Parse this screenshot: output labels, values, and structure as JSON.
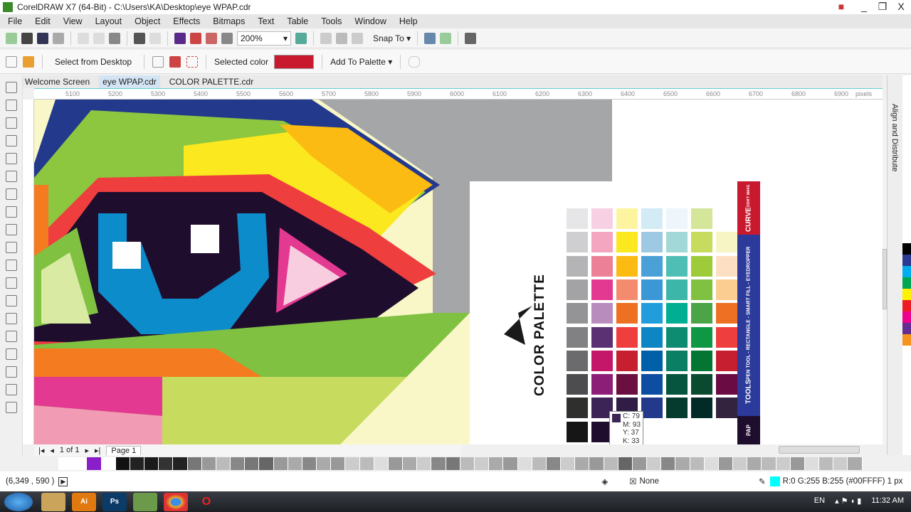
{
  "window": {
    "title": "CorelDRAW X7 (64-Bit) - C:\\Users\\KA\\Desktop\\eye WPAP.cdr",
    "minimize": "_",
    "restore": "❐",
    "close": "X"
  },
  "menu": [
    "File",
    "Edit",
    "View",
    "Layout",
    "Object",
    "Effects",
    "Bitmaps",
    "Text",
    "Table",
    "Tools",
    "Window",
    "Help"
  ],
  "toolbar": {
    "zoom": "200%",
    "snap_to": "Snap To"
  },
  "property_bar": {
    "select_from_desktop": "Select from Desktop",
    "selected_color_label": "Selected color",
    "selected_color": "#c8192e",
    "add_to_palette": "Add To Palette"
  },
  "tabs": [
    {
      "label": "Welcome Screen",
      "active": false
    },
    {
      "label": "eye WPAP.cdr",
      "active": true
    },
    {
      "label": "COLOR PALETTE.cdr",
      "active": false
    }
  ],
  "ruler": {
    "ticks": [
      "5100",
      "5200",
      "5300",
      "5400",
      "5500",
      "5600",
      "5700",
      "5800",
      "5900",
      "6000",
      "6100",
      "6200",
      "6300",
      "6400",
      "6500",
      "6600",
      "6700",
      "6800",
      "6900"
    ],
    "unit": "pixels"
  },
  "dock": {
    "align_distribute": "Align and Distribute"
  },
  "artboard": {
    "title": "COLOR PALETTE",
    "banner_top": "CURVE",
    "banner_top_small": "DON'T MAKE",
    "banner_mid_title": "TOOLS",
    "banner_mid_sub": "PEN TOOL - RECTANGLE - SMART FILL - EYEDROPPER",
    "banner_bottom": "PAP",
    "columns": [
      [
        "#e6e6e8",
        "#cfcfd1",
        "#b4b4b6",
        "#a3a3a5",
        "#949496",
        "#818183",
        "#6b6b6d",
        "#4d4d4f",
        "#2f2f2d",
        "#161616"
      ],
      [
        "#f8d0e4",
        "#f4a5c0",
        "#ec8097",
        "#e33990",
        "#b98cbe",
        "#5b3173",
        "#c4176a",
        "#8d1e77",
        "#3d2456",
        "#1f0d2e"
      ],
      [
        "#fdf4a0",
        "#fbe81e",
        "#fbbb12",
        "#f58b6e",
        "#ee7022",
        "#ee3e3e",
        "#c61f2f",
        "#6b0f40",
        "#301c44",
        null
      ],
      [
        "#d3ebf5",
        "#9dcae2",
        "#4aa1d8",
        "#3b97d6",
        "#219ddb",
        "#0e86c4",
        "#0060a8",
        "#0d4ea2",
        "#233a8c",
        null
      ],
      [
        "#eef6fc",
        "#a3d8d8",
        "#4fbfb5",
        "#3bb6a8",
        "#00ae93",
        "#0d8c72",
        "#0b7f63",
        "#05553f",
        "#053a2e",
        null
      ],
      [
        "#d5e59a",
        "#c7dc5e",
        "#9ecb3a",
        "#80c142",
        "#4ba546",
        "#0f9844",
        "#057532",
        "#0a4a31",
        "#022a27",
        null
      ],
      [
        null,
        "#f7f5c4",
        "#fde0c4",
        "#fbcd90",
        "#ee7022",
        "#ee3e3e",
        "#c61f2f",
        "#6b0b44",
        "#33233f",
        null
      ]
    ]
  },
  "eyedropper_tooltip": {
    "c": "C: 79",
    "m": "M: 93",
    "y": "Y: 37",
    "k": "K: 33",
    "color": "#3c2553"
  },
  "page_nav": {
    "count": "1 of 1",
    "page": "Page 1"
  },
  "status": {
    "coords": "(6,349 , 590 )",
    "fill": "None",
    "outline": "R:0 G:255 B:255 (#00FFFF) 1 px",
    "outline_color": "#00ffff"
  },
  "taskbar": {
    "lang": "EN",
    "time": "11:32 AM"
  },
  "palette_v": [
    "#ffffff",
    "#000000",
    "#2b3990",
    "#00aeef",
    "#00a651",
    "#fff200",
    "#ed1c24",
    "#ec008c",
    "#662d91",
    "#f7941d"
  ]
}
